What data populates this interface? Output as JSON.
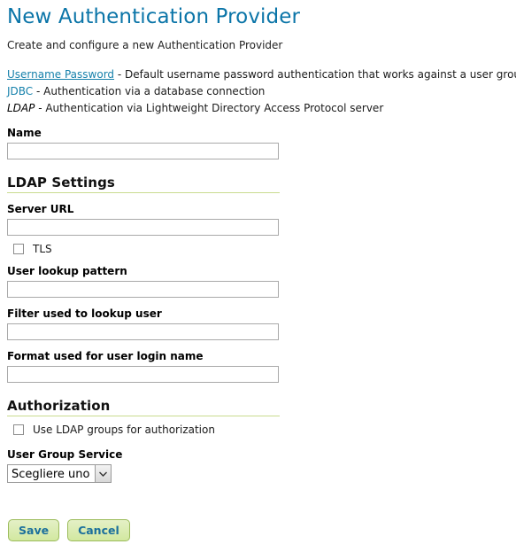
{
  "header": {
    "title": "New Authentication Provider",
    "subtitle": "Create and configure a new Authentication Provider"
  },
  "providers": [
    {
      "name": "Username Password",
      "separator": " - ",
      "description": "Default username password authentication that works against a user group service",
      "state": "link"
    },
    {
      "name": "JDBC",
      "separator": " - ",
      "description": "Authentication via a database connection",
      "state": "link"
    },
    {
      "name": "LDAP",
      "separator": " - ",
      "description": "Authentication via Lightweight Directory Access Protocol server",
      "state": "current"
    }
  ],
  "form": {
    "name": {
      "label": "Name",
      "value": "",
      "placeholder": ""
    }
  },
  "ldap_settings": {
    "section_title": "LDAP Settings",
    "server_url": {
      "label": "Server URL",
      "value": "",
      "placeholder": ""
    },
    "tls": {
      "label": "TLS",
      "checked": false
    },
    "user_lookup_pattern": {
      "label": "User lookup pattern",
      "value": "",
      "placeholder": ""
    },
    "filter_used_to_lookup_user": {
      "label": "Filter used to lookup user",
      "value": "",
      "placeholder": ""
    },
    "format_used_for_user_login_name": {
      "label": "Format used for user login name",
      "value": "",
      "placeholder": ""
    }
  },
  "authorization": {
    "section_title": "Authorization",
    "use_ldap_groups": {
      "label": "Use LDAP groups for authorization",
      "checked": false
    },
    "user_group_service": {
      "label": "User Group Service",
      "selected": "Scegliere uno"
    }
  },
  "actions": {
    "save_label": "Save",
    "cancel_label": "Cancel"
  },
  "colors": {
    "title_blue": "#0b75a8",
    "link_blue": "#1681ab",
    "section_rule_green": "#c9dc8f",
    "button_border_green": "#9cbc5c",
    "button_text_blue": "#1b6f9c"
  }
}
